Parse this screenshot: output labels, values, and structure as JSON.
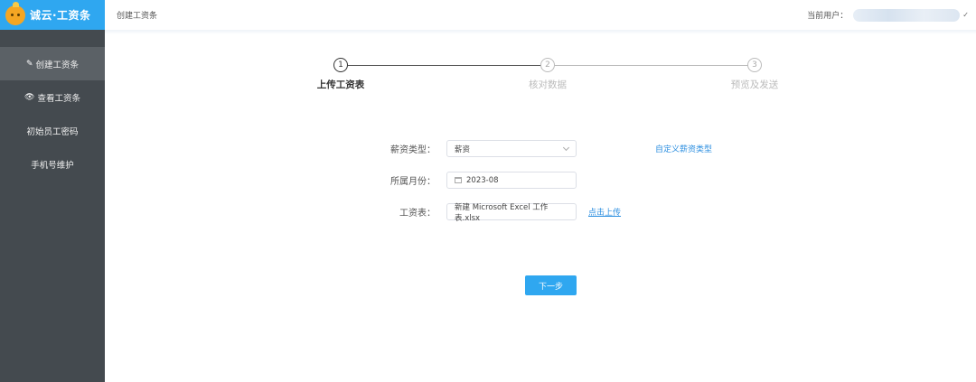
{
  "logo": {
    "text": "诚云·工资条"
  },
  "sidebar": {
    "items": [
      {
        "label": "创建工资条",
        "icon": "✎",
        "active": true
      },
      {
        "label": "查看工资条",
        "icon": "👁",
        "active": false
      },
      {
        "label": "初始员工密码",
        "icon": "",
        "active": false
      },
      {
        "label": "手机号维护",
        "icon": "",
        "active": false
      }
    ]
  },
  "header": {
    "breadcrumb": "创建工资条",
    "user_label": "当前用户：",
    "caret": "✓"
  },
  "steps": [
    {
      "number": "1",
      "title": "上传工资表",
      "active": true
    },
    {
      "number": "2",
      "title": "核对数据",
      "active": false
    },
    {
      "number": "3",
      "title": "预览及发送",
      "active": false
    }
  ],
  "form": {
    "salary_type": {
      "label": "薪资类型：",
      "value": "薪资",
      "link": "自定义薪资类型"
    },
    "month": {
      "label": "所属月份：",
      "value": "2023-08"
    },
    "sheet": {
      "label": "工资表：",
      "value": "新建 Microsoft Excel 工作表.xlsx",
      "link": "点击上传"
    }
  },
  "buttons": {
    "next": "下一步"
  },
  "colors": {
    "accent": "#2fa7f0",
    "sidebar": "#444a4f",
    "link": "#2d8fe0"
  }
}
